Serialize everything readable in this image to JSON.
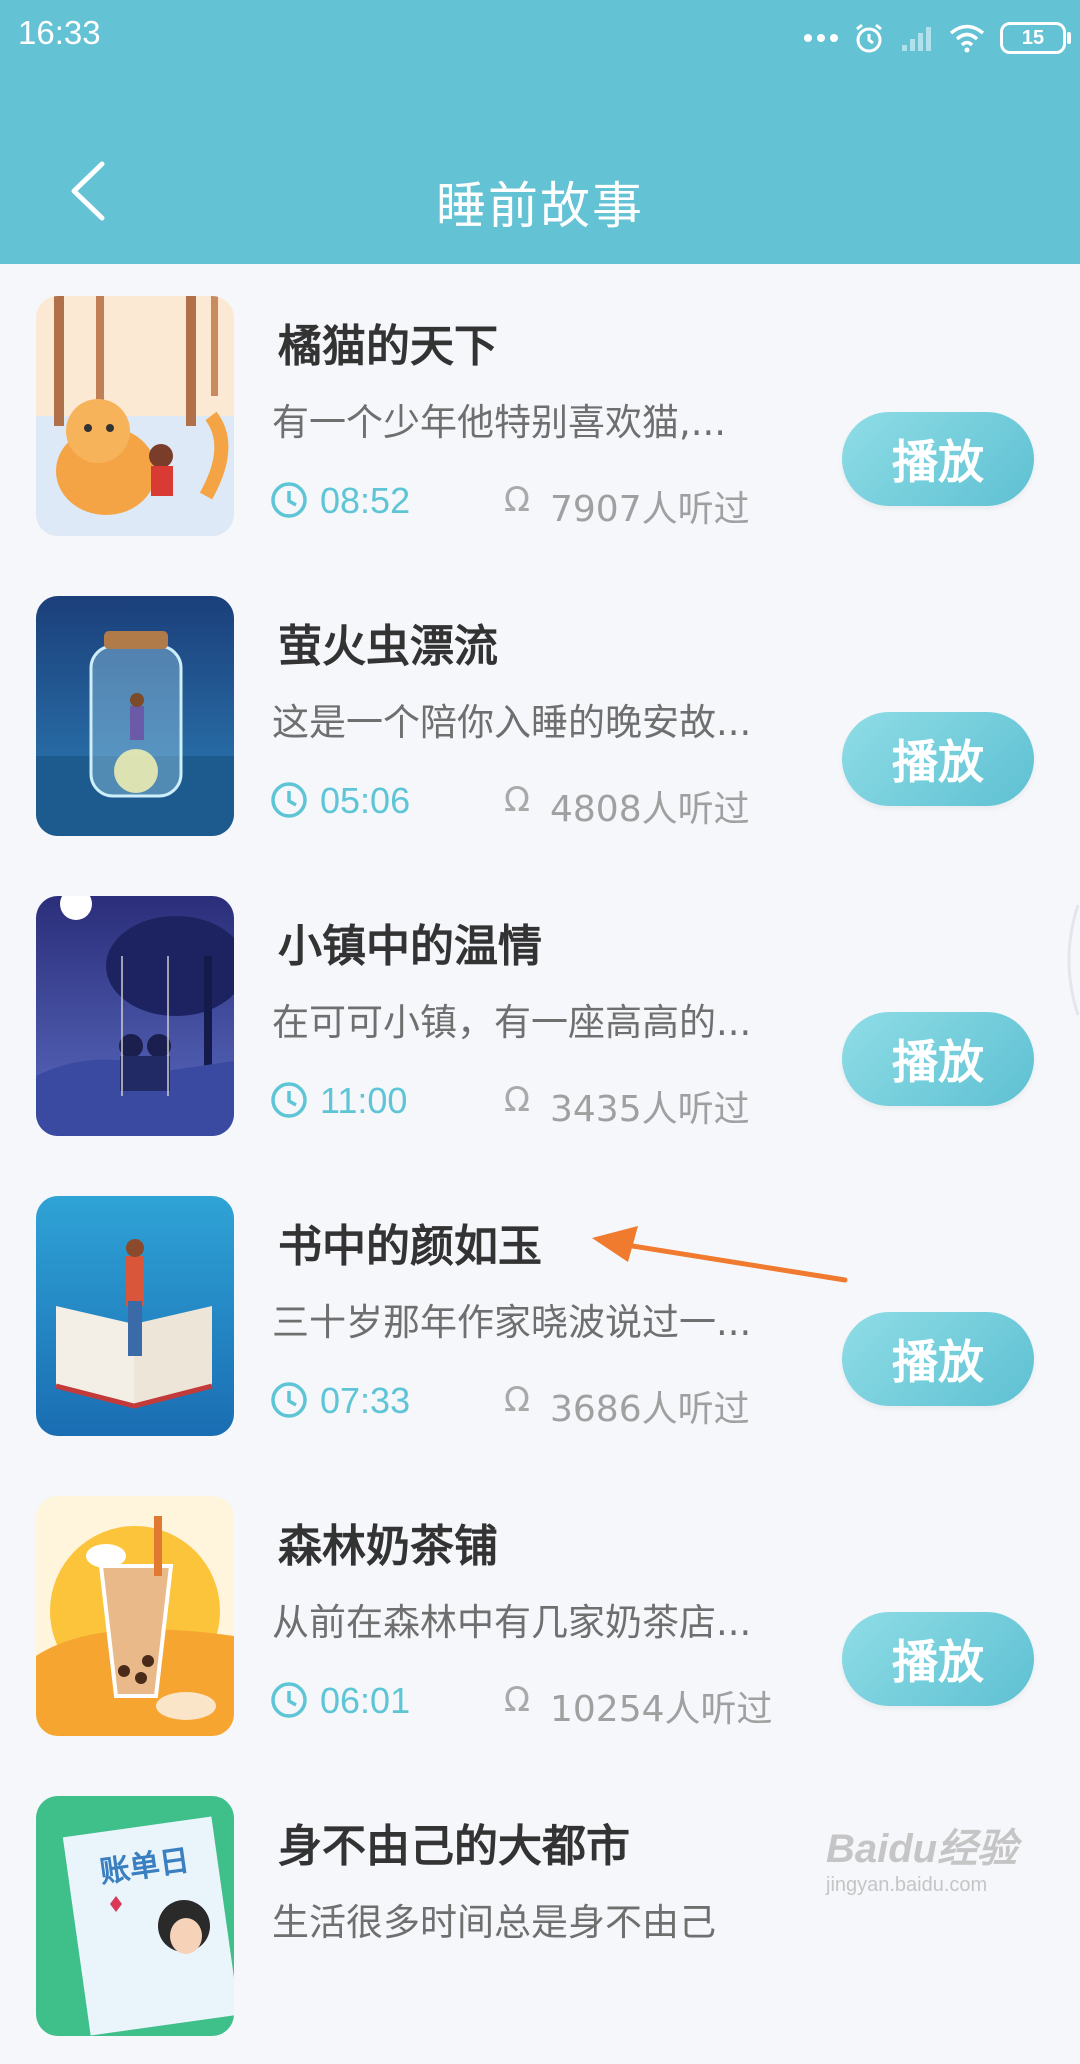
{
  "status_bar": {
    "time": "16:33",
    "battery": "15"
  },
  "header": {
    "title": "睡前故事"
  },
  "stories": [
    {
      "title": "橘猫的天下",
      "desc": "有一个少年他特别喜欢猫,...",
      "duration": "08:52",
      "listens": "7907人听过",
      "play": "播放"
    },
    {
      "title": "萤火虫漂流",
      "desc": "这是一个陪你入睡的晚安故...",
      "duration": "05:06",
      "listens": "4808人听过",
      "play": "播放"
    },
    {
      "title": "小镇中的温情",
      "desc": "在可可小镇，有一座高高的...",
      "duration": "11:00",
      "listens": "3435人听过",
      "play": "播放"
    },
    {
      "title": "书中的颜如玉",
      "desc": "三十岁那年作家晓波说过一...",
      "duration": "07:33",
      "listens": "3686人听过",
      "play": "播放"
    },
    {
      "title": "森林奶茶铺",
      "desc": "从前在森林中有几家奶茶店...",
      "duration": "06:01",
      "listens": "10254人听过",
      "play": "播放"
    },
    {
      "title": "身不由己的大都市",
      "desc": "生活很多时间总是身不由己",
      "duration": "",
      "listens": "",
      "play": ""
    }
  ],
  "thumb_text": {
    "bill": "账单日"
  },
  "watermark": {
    "main": "Baidu经验",
    "sub": "jingyan.baidu.com"
  },
  "colors": {
    "header": "#63c2d4",
    "accent": "#5ec5d6",
    "annotation_arrow": "#f07a2e"
  }
}
